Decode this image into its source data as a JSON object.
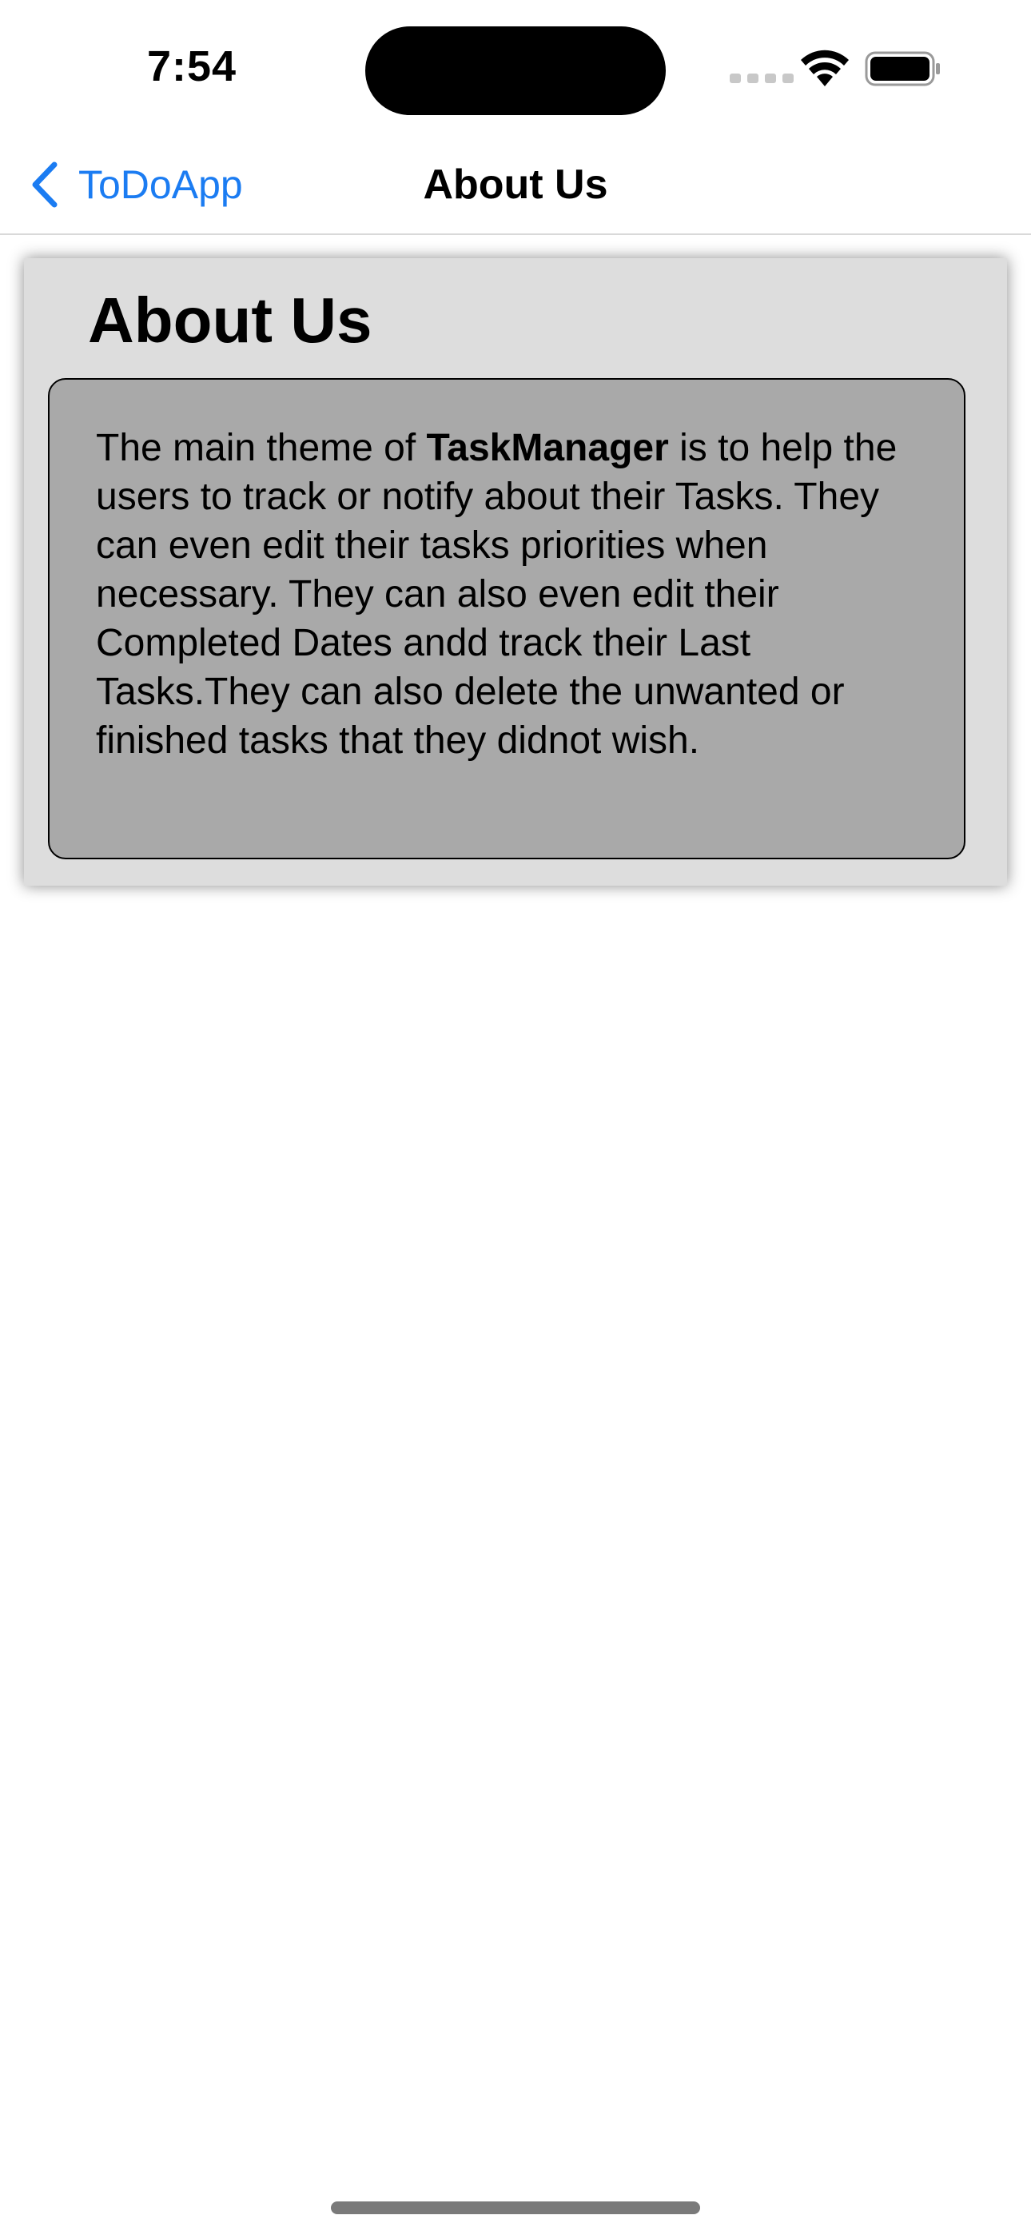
{
  "status_bar": {
    "time": "7:54",
    "icons": [
      "signal-dots-icon",
      "wifi-icon",
      "battery-icon"
    ]
  },
  "nav": {
    "back_label": "ToDoApp",
    "title": "About Us",
    "accent_color": "#1b7cf2"
  },
  "card": {
    "title": "About Us",
    "body": {
      "part1": "The main theme of ",
      "app_name": "TaskManager",
      "part2": " is to help the users to track or notify about their Tasks. They can even edit their tasks priorities when necessary. They can also even edit their Completed Dates andd track their Last Tasks.They can also delete the unwanted or finished tasks that they didnot wish."
    },
    "background_color": "#dddddd",
    "content_box_color": "#a9a9a9"
  }
}
